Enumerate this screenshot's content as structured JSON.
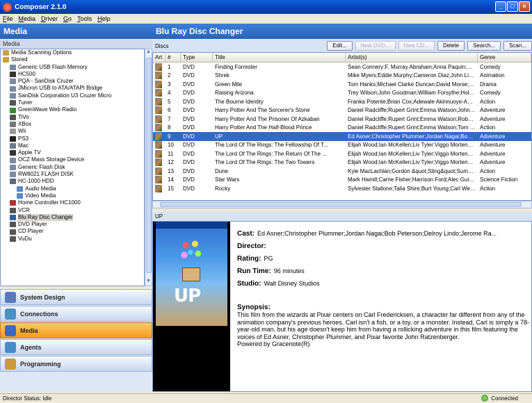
{
  "window": {
    "title": "Composer 2.1.0"
  },
  "menu": [
    "File",
    "Media",
    "Driver",
    "Go",
    "Tools",
    "Help"
  ],
  "left": {
    "header": "Media",
    "subheader": "Media",
    "tree": [
      {
        "label": "Media Scanning Options",
        "indent": 0,
        "icon": "folder-icon",
        "color": "#c9a23a"
      },
      {
        "label": "Stored",
        "indent": 0,
        "icon": "folder-icon",
        "color": "#c9a23a"
      },
      {
        "label": "Generic USB Flash Memory",
        "indent": 1,
        "icon": "usb-icon",
        "color": "#7a8aa0"
      },
      {
        "label": "HC500",
        "indent": 1,
        "icon": "device-icon",
        "color": "#333"
      },
      {
        "label": "PQA - SanDisk Cruzer",
        "indent": 1,
        "icon": "usb-icon",
        "color": "#7a8aa0"
      },
      {
        "label": "JMicron USB to ATA/ATAPI Bridge",
        "indent": 1,
        "icon": "usb-icon",
        "color": "#7a8aa0"
      },
      {
        "label": "SanDisk Corporation U3 Cruzer Micro",
        "indent": 1,
        "icon": "usb-icon",
        "color": "#7a8aa0"
      },
      {
        "label": "Tuner",
        "indent": 1,
        "icon": "tuner-icon",
        "color": "#555"
      },
      {
        "label": "GreenWave Web Radio",
        "indent": 1,
        "icon": "radio-icon",
        "color": "#3a8a3a"
      },
      {
        "label": "TiVo",
        "indent": 1,
        "icon": "tivo-icon",
        "color": "#555"
      },
      {
        "label": "XBox",
        "indent": 1,
        "icon": "xbox-icon",
        "color": "#777"
      },
      {
        "label": "Wii",
        "indent": 1,
        "icon": "wii-icon",
        "color": "#999"
      },
      {
        "label": "PS3",
        "indent": 1,
        "icon": "ps3-icon",
        "color": "#222"
      },
      {
        "label": "Mac",
        "indent": 1,
        "icon": "mac-icon",
        "color": "#6a7a8a"
      },
      {
        "label": "Apple TV",
        "indent": 1,
        "icon": "appletv-icon",
        "color": "#333"
      },
      {
        "label": "OCZ Mass Storage Device",
        "indent": 1,
        "icon": "usb-icon",
        "color": "#7a8aa0"
      },
      {
        "label": "Generic Flash Disk",
        "indent": 1,
        "icon": "usb-icon",
        "color": "#7a8aa0"
      },
      {
        "label": "RW8021 FLASH DISK",
        "indent": 1,
        "icon": "usb-icon",
        "color": "#7a8aa0"
      },
      {
        "label": "HC-1000 HDD",
        "indent": 1,
        "icon": "hdd-icon",
        "color": "#5a6a7a"
      },
      {
        "label": "Audio Media",
        "indent": 2,
        "icon": "audio-icon",
        "color": "#5a8ac8"
      },
      {
        "label": "Video Media",
        "indent": 2,
        "icon": "video-icon",
        "color": "#5a8ac8"
      },
      {
        "label": "Home Controller HC1000",
        "indent": 1,
        "icon": "controller-icon",
        "color": "#b03030"
      },
      {
        "label": "VCR",
        "indent": 1,
        "icon": "vcr-icon",
        "color": "#555"
      },
      {
        "label": "Blu Ray Disc Changer",
        "indent": 1,
        "icon": "disc-icon",
        "color": "#3060a0",
        "selected": true
      },
      {
        "label": "DVD Player",
        "indent": 1,
        "icon": "dvd-icon",
        "color": "#555"
      },
      {
        "label": "CD Player",
        "indent": 1,
        "icon": "cd-icon",
        "color": "#555"
      },
      {
        "label": "VuDu",
        "indent": 1,
        "icon": "vudu-icon",
        "color": "#555"
      }
    ],
    "nav": [
      {
        "label": "System Design",
        "icon": "system-design-icon",
        "color": "#5a7ab8"
      },
      {
        "label": "Connections",
        "icon": "connections-icon",
        "color": "#4a90c0"
      },
      {
        "label": "Media",
        "icon": "media-icon",
        "color": "#3a6ac0",
        "active": true
      },
      {
        "label": "Agents",
        "icon": "agents-icon",
        "color": "#4a8ac8"
      },
      {
        "label": "Programming",
        "icon": "programming-icon",
        "color": "#c89a3a"
      }
    ]
  },
  "right": {
    "header": "Blu Ray Disc Changer",
    "toolbar": {
      "label": "Discs",
      "buttons": [
        {
          "label": "Edit...",
          "enabled": true
        },
        {
          "label": "New DVD...",
          "enabled": false
        },
        {
          "label": "New CD...",
          "enabled": false
        },
        {
          "label": "Delete",
          "enabled": true
        },
        {
          "label": "Search...",
          "enabled": true
        },
        {
          "label": "Scan...",
          "enabled": true
        }
      ]
    },
    "columns": [
      "Art",
      "#",
      "Type",
      "Title",
      "Artist(s)",
      "Genre"
    ],
    "rows": [
      {
        "num": "1",
        "type": "DVD",
        "title": "Finding Forrester",
        "artist": "Sean Connery;F. Murray Abraham;Anna Paquin;Bus...",
        "genre": "Comedy"
      },
      {
        "num": "2",
        "type": "DVD",
        "title": "Shrek",
        "artist": "Mike Myers;Eddie Murphy;Cameron Diaz;John Lithg...",
        "genre": "Animation"
      },
      {
        "num": "3",
        "type": "DVD",
        "title": "Green Mile",
        "artist": "Tom Hanks;Michael Clarke Duncan;David Morse;B...",
        "genre": "Drama"
      },
      {
        "num": "4",
        "type": "DVD",
        "title": "Raising Arizona",
        "artist": "Trey Wilson;John Goodman;William Forsythe;Holly ...",
        "genre": "Comedy"
      },
      {
        "num": "5",
        "type": "DVD",
        "title": "The Bourne Identity",
        "artist": "Franka Potente;Brian Cox;Adewale Akinnuoye-Agba...",
        "genre": "Action"
      },
      {
        "num": "6",
        "type": "DVD",
        "title": "Harry Potter And The Sorcerer's Stone",
        "artist": "Daniel Radcliffe;Rupert Grint;Emma Watson;John Cl...",
        "genre": "Adventure"
      },
      {
        "num": "7",
        "type": "DVD",
        "title": "Harry Potter And The Prisoner Of Azkaban",
        "artist": "Daniel Radcliffe;Rupert Grint;Emma Watson;Robbie...",
        "genre": "Adventure"
      },
      {
        "num": "8",
        "type": "DVD",
        "title": "Harry Potter And The Half-Blood Prince",
        "artist": "Daniel Radcliffe;Rupert Grint;Emma Watson;Tom Fe...",
        "genre": "Action"
      },
      {
        "num": "9",
        "type": "DVD",
        "title": "UP",
        "artist": "Ed Asner;Christopher Plummer;Jordan Nagai;Bob Pe...",
        "genre": "Adventure",
        "selected": true
      },
      {
        "num": "10",
        "type": "DVD",
        "title": "The Lord Of The Rings: The Fellowship Of T...",
        "artist": "Elijah Wood;Ian McKellen;Liv Tyler;Viggo Mortense...",
        "genre": "Adventure"
      },
      {
        "num": "11",
        "type": "DVD",
        "title": "The Lord Of The Rings: The Return Of The ...",
        "artist": "Elijah Wood;Ian McKellen;Liv Tyler;Viggo Mortense...",
        "genre": "Adventure"
      },
      {
        "num": "12",
        "type": "DVD",
        "title": "The Lord Of The Rings: The Two Towers",
        "artist": "Elijah Wood;Ian McKellen;Liv Tyler;Viggo Mortense...",
        "genre": "Adventure"
      },
      {
        "num": "13",
        "type": "DVD",
        "title": "Dune",
        "artist": "Kyle MacLachlan;Gordon &quot;Sting&quot;Sumner;...",
        "genre": "Action"
      },
      {
        "num": "14",
        "type": "DVD",
        "title": "Star Wars",
        "artist": "Mark Hamill;Carrie Fisher;Harrison Ford;Alec Guinne...",
        "genre": "Science Fiction"
      },
      {
        "num": "15",
        "type": "DVD",
        "title": "Rocky",
        "artist": "Sylvester Stallone;Talia Shire;Burt Young;Carl Weat...",
        "genre": "Action"
      }
    ],
    "detail": {
      "header": "UP",
      "poster_text": "UP",
      "cast_label": "Cast:",
      "cast": "Ed Asner;Christopher Plummer;Jordan Nagai;Bob Peterson;Delroy Lindo;Jerome Ra...",
      "director_label": "Director:",
      "director": "",
      "rating_label": "Rating:",
      "rating": "PG",
      "runtime_label": "Run Time:",
      "runtime": "96 minutes",
      "studio_label": "Studio:",
      "studio": "Walt Disney Studios",
      "synopsis_label": "Synopsis:",
      "synopsis": "This film from the wizards at Pixar centers on Carl Fredericksen, a character far different from any of the animation company's previous heroes. Carl isn't a fish, or a toy, or a monster. Instead, Carl is simply a 78-year-old man, but his age doesn't keep him from having a rollicking adventure in this film featuring the voices of Ed Asner, Christopher Plummer, and Pixar favorite John Ratzenberger.",
      "powered_by": "Powered by Gracenote(R)"
    }
  },
  "status": {
    "text": "Director Status: Idle",
    "connection": "Connected"
  }
}
